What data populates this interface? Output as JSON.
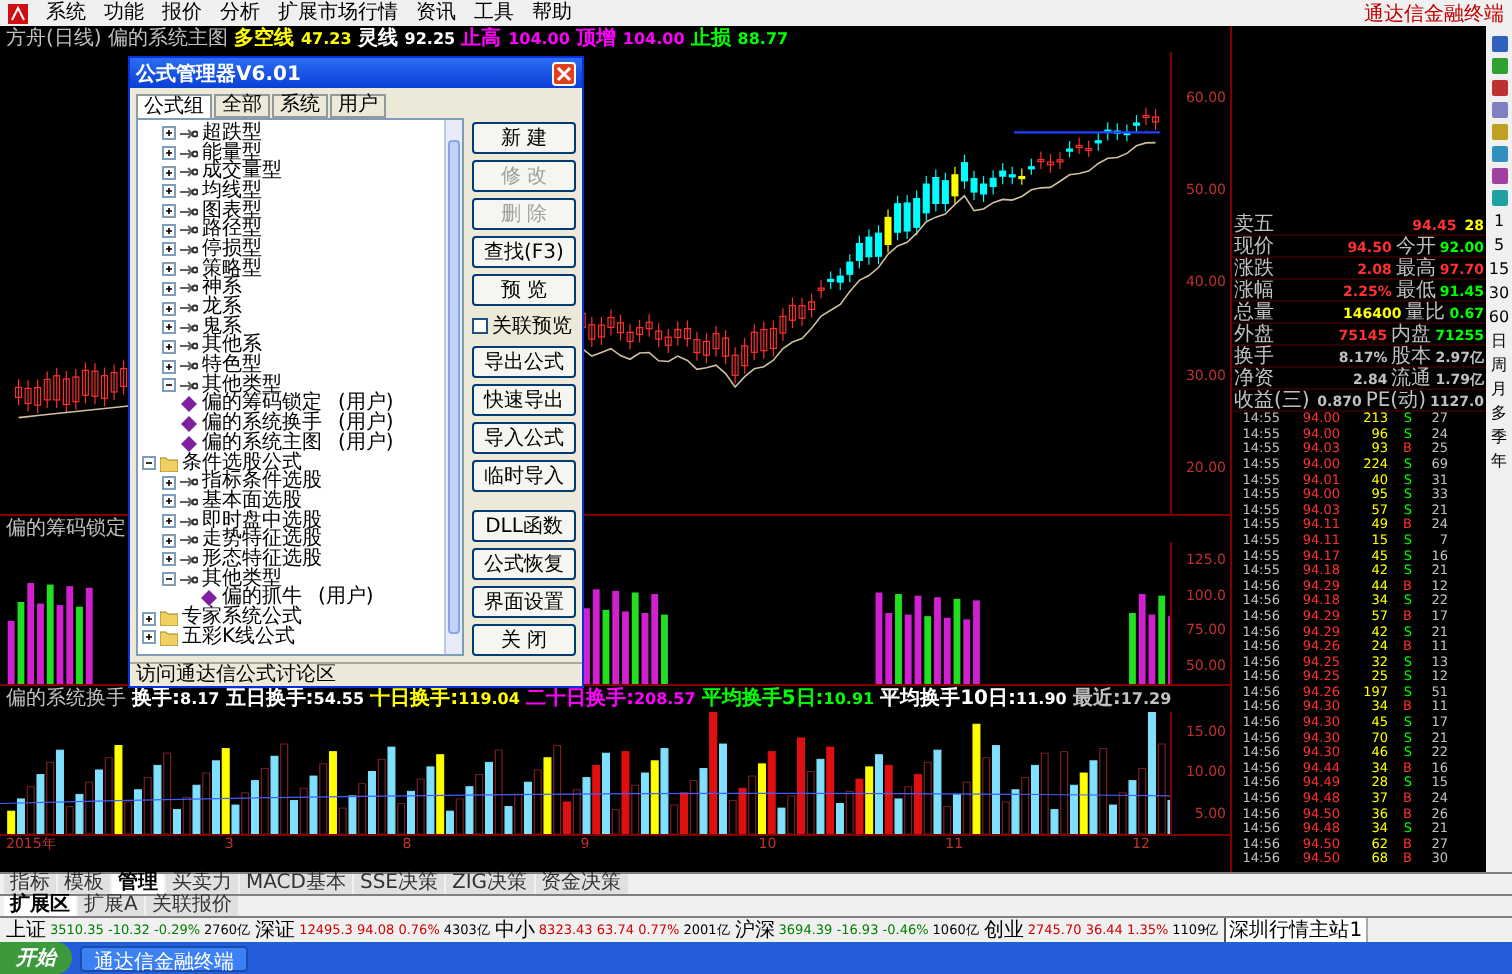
{
  "menu": [
    "系统",
    "功能",
    "报价",
    "分析",
    "扩展市场行情",
    "资讯",
    "工具",
    "帮助"
  ],
  "brand": "通达信金融终端",
  "chart_header": {
    "title": "方舟(日线) 偏的系统主图",
    "fields": [
      {
        "label": "多空线",
        "value": "47.23",
        "color": "#ffff00"
      },
      {
        "label": "灵线",
        "value": "92.25",
        "color": "#ffffff"
      },
      {
        "label": "止高",
        "value": "104.00",
        "color": "#ff00ff"
      },
      {
        "label": "顶增",
        "value": "104.00",
        "color": "#ff00ff"
      },
      {
        "label": "止损",
        "value": "88.77",
        "color": "#00ff00"
      }
    ]
  },
  "main_axis": [
    "60.00",
    "50.00",
    "40.00",
    "30.00",
    "20.00"
  ],
  "panel2": {
    "title": "偏的筹码锁定",
    "axis": [
      "125.0",
      "100.0",
      "75.00",
      "50.00"
    ]
  },
  "panel3": {
    "title": "偏的系统换手",
    "fields": [
      {
        "label": "换手:",
        "value": "8.17",
        "color": "#ffffff"
      },
      {
        "label": "五日换手:",
        "value": "54.55",
        "color": "#ffffff"
      },
      {
        "label": "十日换手:",
        "value": "119.04",
        "color": "#ffff00"
      },
      {
        "label": "二十日换手:",
        "value": "208.57",
        "color": "#ff00ff"
      },
      {
        "label": "平均换手5日:",
        "value": "10.91",
        "color": "#00ff00"
      },
      {
        "label": "平均换手10日:",
        "value": "11.90",
        "color": "#ffffff"
      },
      {
        "label": "最近:",
        "value": "17.29",
        "color": "#c0c0c0"
      }
    ],
    "axis": [
      "15.00",
      "10.00",
      "5.00"
    ]
  },
  "date_axis": [
    "2015年",
    "3",
    "8",
    "9",
    "10",
    "11",
    "12"
  ],
  "dialog": {
    "title": "公式管理器V6.01",
    "tabs": [
      {
        "label": "公式组",
        "selected": true
      },
      {
        "label": "全部",
        "selected": false
      },
      {
        "label": "系统",
        "selected": false
      },
      {
        "label": "用户",
        "selected": false
      }
    ],
    "tree": [
      {
        "kind": "group",
        "label": "超跌型",
        "expanded": false
      },
      {
        "kind": "group",
        "label": "能量型",
        "expanded": false
      },
      {
        "kind": "group",
        "label": "成交量型",
        "expanded": false
      },
      {
        "kind": "group",
        "label": "均线型",
        "expanded": false
      },
      {
        "kind": "group",
        "label": "图表型",
        "expanded": false
      },
      {
        "kind": "group",
        "label": "路径型",
        "expanded": false
      },
      {
        "kind": "group",
        "label": "停损型",
        "expanded": false
      },
      {
        "kind": "group",
        "label": "策略型",
        "expanded": false
      },
      {
        "kind": "group",
        "label": "神系",
        "expanded": false
      },
      {
        "kind": "group",
        "label": "龙系",
        "expanded": false
      },
      {
        "kind": "group",
        "label": "鬼系",
        "expanded": false
      },
      {
        "kind": "group",
        "label": "其他系",
        "expanded": false
      },
      {
        "kind": "group",
        "label": "特色型",
        "expanded": false
      },
      {
        "kind": "group",
        "label": "其他类型",
        "expanded": true,
        "children": [
          {
            "kind": "formula",
            "label": "偏的筹码锁定",
            "owner": "(用户)"
          },
          {
            "kind": "formula",
            "label": "偏的系统换手",
            "owner": "(用户)"
          },
          {
            "kind": "formula",
            "label": "偏的系统主图",
            "owner": "(用户)"
          }
        ]
      },
      {
        "kind": "folder",
        "label": "条件选股公式",
        "expanded": true,
        "children": [
          {
            "kind": "group",
            "label": "指标条件选股",
            "expanded": false
          },
          {
            "kind": "group",
            "label": "基本面选股",
            "expanded": false
          },
          {
            "kind": "group",
            "label": "即时盘中选股",
            "expanded": false
          },
          {
            "kind": "group",
            "label": "走势特征选股",
            "expanded": false
          },
          {
            "kind": "group",
            "label": "形态特征选股",
            "expanded": false
          },
          {
            "kind": "group",
            "label": "其他类型",
            "expanded": true,
            "children": [
              {
                "kind": "formula",
                "label": "偏的抓牛",
                "owner": "(用户)"
              }
            ]
          }
        ]
      },
      {
        "kind": "folder",
        "label": "专家系统公式",
        "expanded": false
      },
      {
        "kind": "folder",
        "label": "五彩K线公式",
        "expanded": false
      }
    ],
    "buttons_top": [
      {
        "label": "新 建",
        "disabled": false
      },
      {
        "label": "修 改",
        "disabled": true
      },
      {
        "label": "删 除",
        "disabled": true
      },
      {
        "label": "查找(F3)",
        "disabled": false
      },
      {
        "label": "预 览",
        "disabled": false
      }
    ],
    "preview_checkbox": {
      "label": "关联预览",
      "checked": false
    },
    "buttons_bottom": [
      {
        "label": "导出公式",
        "disabled": false
      },
      {
        "label": "快速导出",
        "disabled": false
      },
      {
        "label": "导入公式",
        "disabled": false
      },
      {
        "label": "临时导入",
        "disabled": false
      },
      {
        "label": "DLL函数",
        "disabled": false
      },
      {
        "label": "公式恢复",
        "disabled": false
      },
      {
        "label": "界面设置",
        "disabled": false
      },
      {
        "label": "关 闭",
        "disabled": false
      }
    ],
    "status": "访问通达信公式讨论区"
  },
  "quote": [
    {
      "left": {
        "label": "卖五",
        "value": "94.45",
        "color": "#ff3030"
      },
      "right": {
        "value": "28",
        "color": "#ffff00"
      }
    },
    {
      "left": {
        "label": "现价",
        "value": "94.50",
        "color": "#ff3030"
      },
      "right": {
        "label": "今开",
        "value": "92.00",
        "color": "#00ff00"
      }
    },
    {
      "left": {
        "label": "涨跌",
        "value": "2.08",
        "color": "#ff3030"
      },
      "right": {
        "label": "最高",
        "value": "97.70",
        "color": "#ff3030"
      }
    },
    {
      "left": {
        "label": "涨幅",
        "value": "2.25%",
        "color": "#ff3030"
      },
      "right": {
        "label": "最低",
        "value": "91.45",
        "color": "#00ff00"
      }
    },
    {
      "left": {
        "label": "总量",
        "value": "146400",
        "color": "#ffff00"
      },
      "right": {
        "label": "量比",
        "value": "0.67",
        "color": "#00ff00"
      }
    },
    {
      "left": {
        "label": "外盘",
        "value": "75145",
        "color": "#ff3030"
      },
      "right": {
        "label": "内盘",
        "value": "71255",
        "color": "#00ff00"
      }
    },
    {
      "left": {
        "label": "换手",
        "value": "8.17%",
        "color": "#c0c0c0"
      },
      "right": {
        "label": "股本",
        "value": "2.97亿",
        "color": "#c0c0c0"
      }
    },
    {
      "left": {
        "label": "净资",
        "value": "2.84",
        "color": "#c0c0c0"
      },
      "right": {
        "label": "流通",
        "value": "1.79亿",
        "color": "#c0c0c0"
      }
    },
    {
      "left": {
        "label": "收益(三)",
        "value": "0.870",
        "color": "#c0c0c0"
      },
      "right": {
        "label": "PE(动)",
        "value": "1127.0",
        "color": "#c0c0c0"
      }
    }
  ],
  "ticks": [
    {
      "time": "14:55",
      "price": "94.00",
      "volume": "213",
      "side": "S",
      "count": "27"
    },
    {
      "time": "14:55",
      "price": "94.00",
      "volume": "96",
      "side": "S",
      "count": "24"
    },
    {
      "time": "14:55",
      "price": "94.03",
      "volume": "93",
      "side": "B",
      "count": "25"
    },
    {
      "time": "14:55",
      "price": "94.00",
      "volume": "224",
      "side": "S",
      "count": "69"
    },
    {
      "time": "14:55",
      "price": "94.01",
      "volume": "40",
      "side": "S",
      "count": "31"
    },
    {
      "time": "14:55",
      "price": "94.00",
      "volume": "95",
      "side": "S",
      "count": "33"
    },
    {
      "time": "14:55",
      "price": "94.03",
      "volume": "57",
      "side": "S",
      "count": "21"
    },
    {
      "time": "14:55",
      "price": "94.11",
      "volume": "49",
      "side": "B",
      "count": "24"
    },
    {
      "time": "14:55",
      "price": "94.11",
      "volume": "15",
      "side": "S",
      "count": "7"
    },
    {
      "time": "14:55",
      "price": "94.17",
      "volume": "45",
      "side": "S",
      "count": "16"
    },
    {
      "time": "14:55",
      "price": "94.18",
      "volume": "42",
      "side": "S",
      "count": "21"
    },
    {
      "time": "14:56",
      "price": "94.29",
      "volume": "44",
      "side": "B",
      "count": "12"
    },
    {
      "time": "14:56",
      "price": "94.18",
      "volume": "34",
      "side": "S",
      "count": "22"
    },
    {
      "time": "14:56",
      "price": "94.29",
      "volume": "57",
      "side": "B",
      "count": "17"
    },
    {
      "time": "14:56",
      "price": "94.29",
      "volume": "42",
      "side": "S",
      "count": "21"
    },
    {
      "time": "14:56",
      "price": "94.26",
      "volume": "24",
      "side": "B",
      "count": "11"
    },
    {
      "time": "14:56",
      "price": "94.25",
      "volume": "32",
      "side": "S",
      "count": "13"
    },
    {
      "time": "14:56",
      "price": "94.25",
      "volume": "25",
      "side": "S",
      "count": "12"
    },
    {
      "time": "14:56",
      "price": "94.26",
      "volume": "197",
      "side": "S",
      "count": "51"
    },
    {
      "time": "14:56",
      "price": "94.30",
      "volume": "34",
      "side": "B",
      "count": "11"
    },
    {
      "time": "14:56",
      "price": "94.30",
      "volume": "45",
      "side": "S",
      "count": "17"
    },
    {
      "time": "14:56",
      "price": "94.30",
      "volume": "70",
      "side": "S",
      "count": "21"
    },
    {
      "time": "14:56",
      "price": "94.30",
      "volume": "46",
      "side": "S",
      "count": "22"
    },
    {
      "time": "14:56",
      "price": "94.44",
      "volume": "34",
      "side": "B",
      "count": "16"
    },
    {
      "time": "14:56",
      "price": "94.49",
      "volume": "28",
      "side": "S",
      "count": "15"
    },
    {
      "time": "14:56",
      "price": "94.48",
      "volume": "37",
      "side": "B",
      "count": "24"
    },
    {
      "time": "14:56",
      "price": "94.50",
      "volume": "36",
      "side": "B",
      "count": "26"
    },
    {
      "time": "14:56",
      "price": "94.48",
      "volume": "34",
      "side": "S",
      "count": "21"
    },
    {
      "time": "14:56",
      "price": "94.50",
      "volume": "62",
      "side": "B",
      "count": "27"
    },
    {
      "time": "14:56",
      "price": "94.50",
      "volume": "68",
      "side": "B",
      "count": "30"
    }
  ],
  "side_toolbar": [
    "1",
    "5",
    "15",
    "30",
    "60",
    "日",
    "周",
    "月",
    "多",
    "季",
    "年"
  ],
  "bottom_tabs": [
    {
      "label": "指标",
      "selected": false
    },
    {
      "label": "模板",
      "selected": false
    },
    {
      "label": "管理",
      "selected": true
    },
    {
      "label": "买卖力",
      "selected": false
    },
    {
      "label": "MACD基本",
      "selected": false
    },
    {
      "label": "SSE决策",
      "selected": false
    },
    {
      "label": "ZIG决策",
      "selected": false
    },
    {
      "label": "资金决策",
      "selected": false
    }
  ],
  "bottom_tabs2": [
    {
      "label": "扩展区",
      "selected": true
    },
    {
      "label": "扩展A",
      "selected": false
    },
    {
      "label": "关联报价",
      "selected": false
    }
  ],
  "indices": [
    {
      "name": "上证",
      "value": "3510.35",
      "change": "-10.32",
      "pct": "-0.29%",
      "amount": "2760亿",
      "color": "#008000"
    },
    {
      "name": "深证",
      "value": "12495.3",
      "change": "94.08",
      "pct": "0.76%",
      "amount": "4303亿",
      "color": "#d00000"
    },
    {
      "name": "中小",
      "value": "8323.43",
      "change": "63.74",
      "pct": "0.77%",
      "amount": "2001亿",
      "color": "#d00000"
    },
    {
      "name": "沪深",
      "value": "3694.39",
      "change": "-16.93",
      "pct": "-0.46%",
      "amount": "1060亿",
      "color": "#008000"
    },
    {
      "name": "创业",
      "value": "2745.70",
      "change": "36.44",
      "pct": "1.35%",
      "amount": "1109亿",
      "color": "#d00000"
    }
  ],
  "server": "深圳行情主站1",
  "taskbar": {
    "start": "开始",
    "tasks": [
      "通达信金融终端"
    ]
  }
}
